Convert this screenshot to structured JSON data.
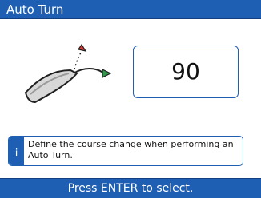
{
  "window": {
    "title": "Auto Turn"
  },
  "main": {
    "illustration_icon": "boat-course-change-icon",
    "value": "90"
  },
  "info": {
    "icon": "info-icon",
    "icon_glyph": "i",
    "text": "Define the course change when performing an Auto Turn."
  },
  "footer": {
    "hint": "Press ENTER to select."
  },
  "colors": {
    "accent": "#1e5fb4",
    "accent_dark": "#123f80",
    "arrow_red": "#e23a3a",
    "arrow_green": "#2f9a4a",
    "boat_gray": "#d8d8d8",
    "outline": "#202020"
  }
}
